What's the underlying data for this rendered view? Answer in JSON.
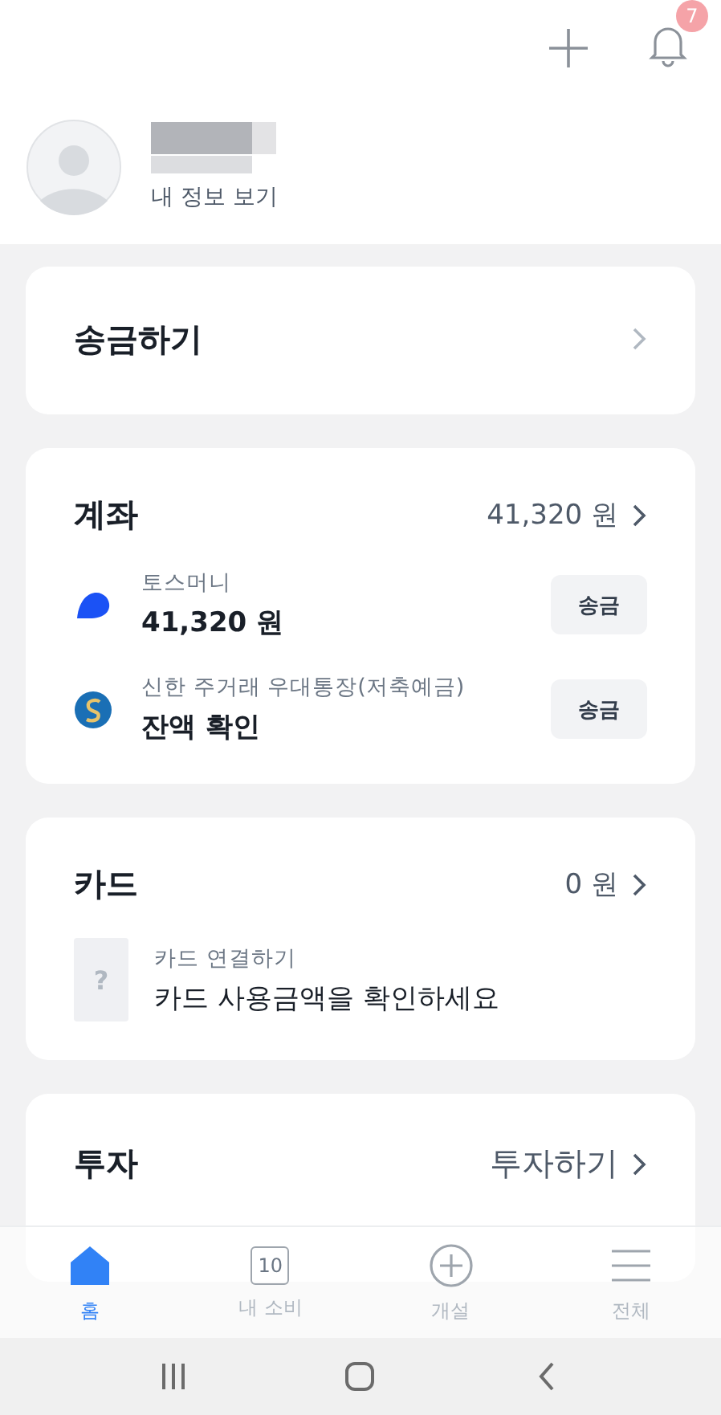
{
  "header": {
    "notification_badge": "7"
  },
  "profile": {
    "link": "내 정보 보기"
  },
  "transfer_card": {
    "title": "송금하기"
  },
  "accounts_card": {
    "title": "계좌",
    "total": "41,320 원",
    "items": [
      {
        "kind": "toss",
        "name": "토스머니",
        "balance": "41,320 원",
        "button": "송금"
      },
      {
        "kind": "bank",
        "name": "신한 주거래 우대통장(저축예금)",
        "balance": "잔액 확인",
        "button": "송금"
      }
    ]
  },
  "card_card": {
    "title": "카드",
    "total": "0 원",
    "item": {
      "icon": "?",
      "name": "카드 연결하기",
      "text": "카드 사용금액을 확인하세요"
    }
  },
  "invest_card": {
    "title": "투자",
    "action": "투자하기"
  },
  "bottom_nav": [
    {
      "kind": "home",
      "label": "홈",
      "selected": true
    },
    {
      "kind": "calendar",
      "icon_text": "10",
      "label": "내 소비",
      "selected": false
    },
    {
      "kind": "plus",
      "label": "개설",
      "selected": false
    },
    {
      "kind": "menu",
      "label": "전체",
      "selected": false
    }
  ]
}
